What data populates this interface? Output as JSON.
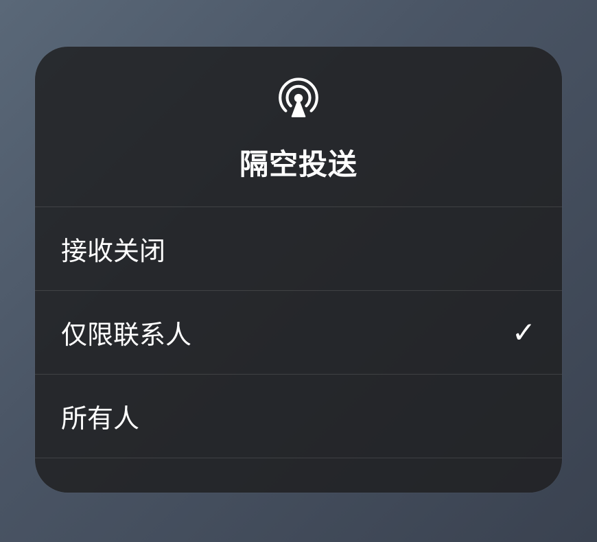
{
  "airdrop": {
    "title": "隔空投送",
    "options": [
      {
        "label": "接收关闭",
        "selected": false
      },
      {
        "label": "仅限联系人",
        "selected": true
      },
      {
        "label": "所有人",
        "selected": false
      }
    ]
  }
}
